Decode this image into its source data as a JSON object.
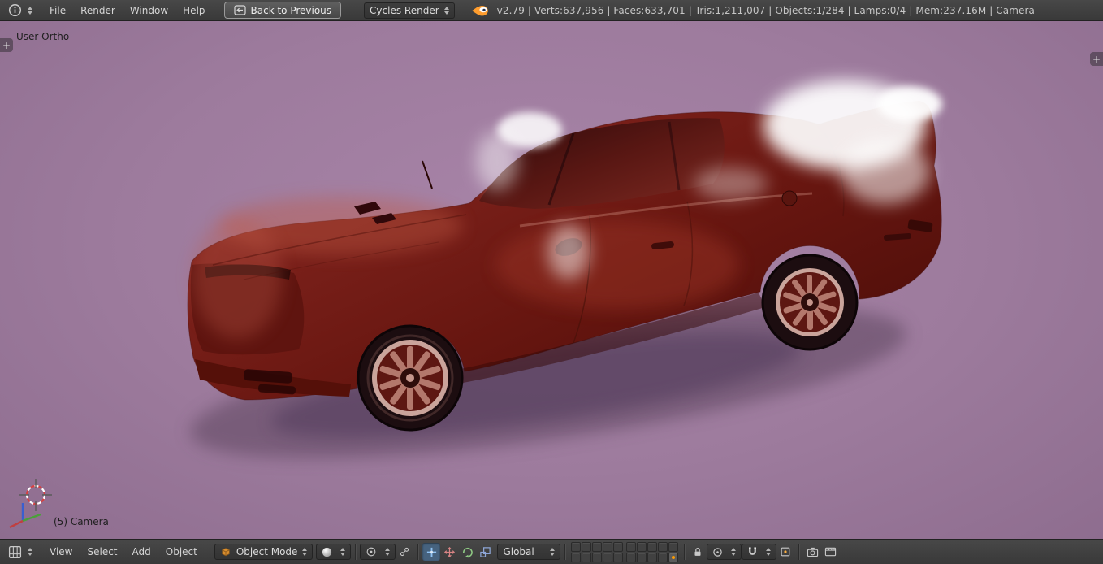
{
  "top_header": {
    "menus": [
      {
        "label": "File"
      },
      {
        "label": "Render"
      },
      {
        "label": "Window"
      },
      {
        "label": "Help"
      }
    ],
    "back_button": "Back to Previous",
    "render_engine": "Cycles Render",
    "stats": "v2.79 | Verts:637,956 | Faces:633,701 | Tris:1,211,007 | Objects:1/284 | Lamps:0/4 | Mem:237.16M | Camera"
  },
  "viewport": {
    "view_name": "User Ortho",
    "active_object": "(5) Camera"
  },
  "bottom_header": {
    "menus": [
      {
        "label": "View"
      },
      {
        "label": "Select"
      },
      {
        "label": "Add"
      },
      {
        "label": "Object"
      }
    ],
    "mode": "Object Mode",
    "orientation": "Global"
  },
  "icons": {
    "plus": "+"
  },
  "colors": {
    "header_bg": "#3e3e3e",
    "viewport_bg": "#9d7b9d",
    "car_body": "#7c211b",
    "accent_orange": "#ff9c00"
  }
}
